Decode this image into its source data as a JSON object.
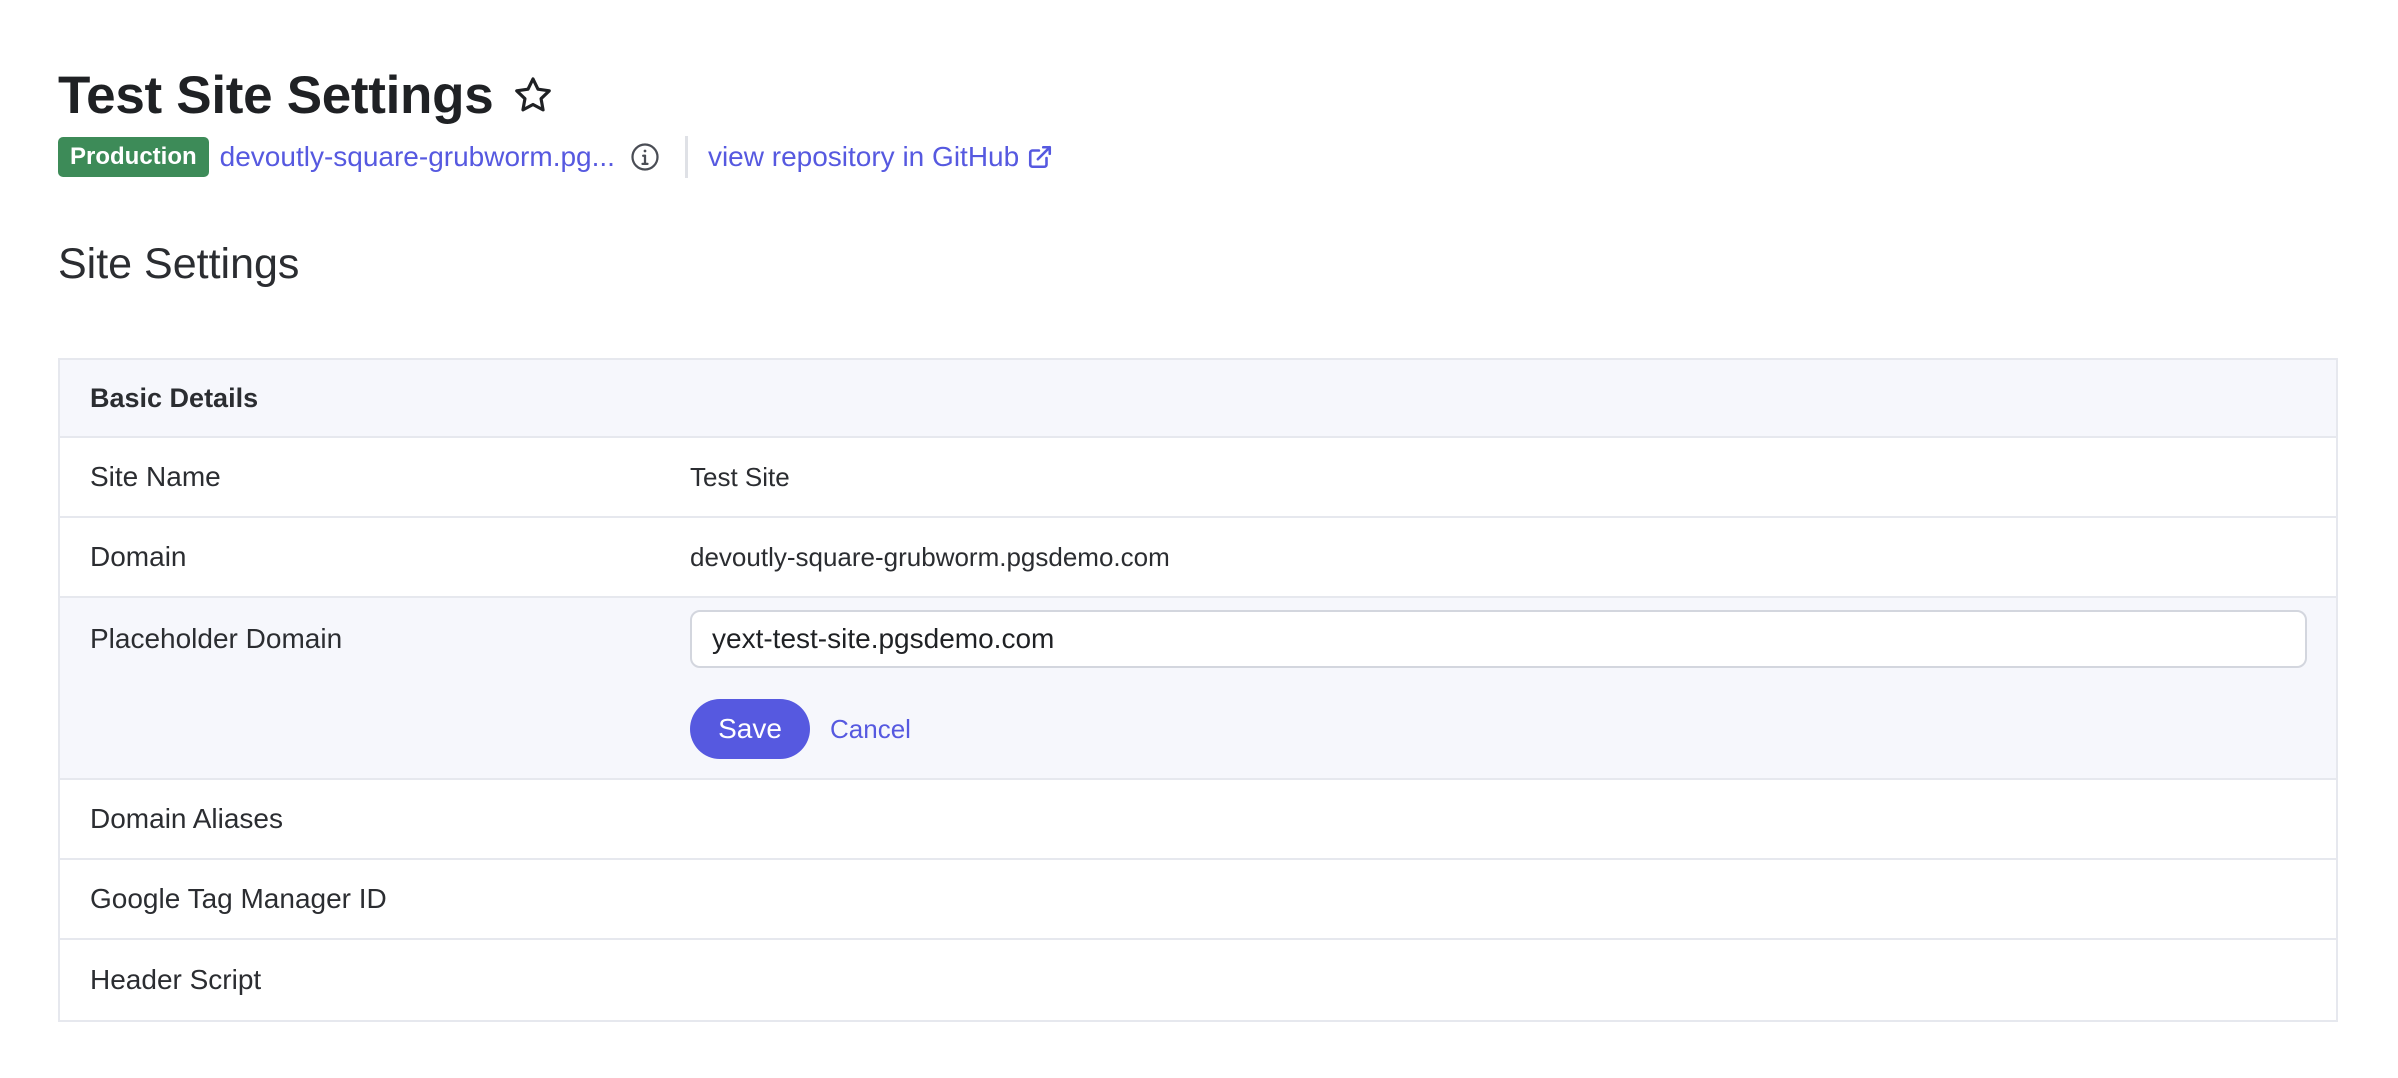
{
  "header": {
    "title": "Test Site Settings",
    "badge": "Production",
    "site_link": "devoutly-square-grubworm.pg...",
    "repo_link": "view repository in GitHub",
    "icons": {
      "favorite": "star-outline-icon",
      "info": "info-icon",
      "external": "external-link-icon"
    }
  },
  "section_title": "Site Settings",
  "basic_details": {
    "heading": "Basic Details",
    "rows": [
      {
        "label": "Site Name",
        "value": "Test Site"
      },
      {
        "label": "Domain",
        "value": "devoutly-square-grubworm.pgsdemo.com"
      },
      {
        "label": "Placeholder Domain",
        "input_value": "yext-test-site.pgsdemo.com",
        "save_label": "Save",
        "cancel_label": "Cancel"
      },
      {
        "label": "Domain Aliases",
        "value": ""
      },
      {
        "label": "Google Tag Manager ID",
        "value": ""
      },
      {
        "label": "Header Script",
        "value": ""
      }
    ]
  },
  "colors": {
    "accent": "#5659e0",
    "badge_green": "#3d8b58",
    "header_bg": "#f6f7fc",
    "border": "#e6e8ee"
  }
}
